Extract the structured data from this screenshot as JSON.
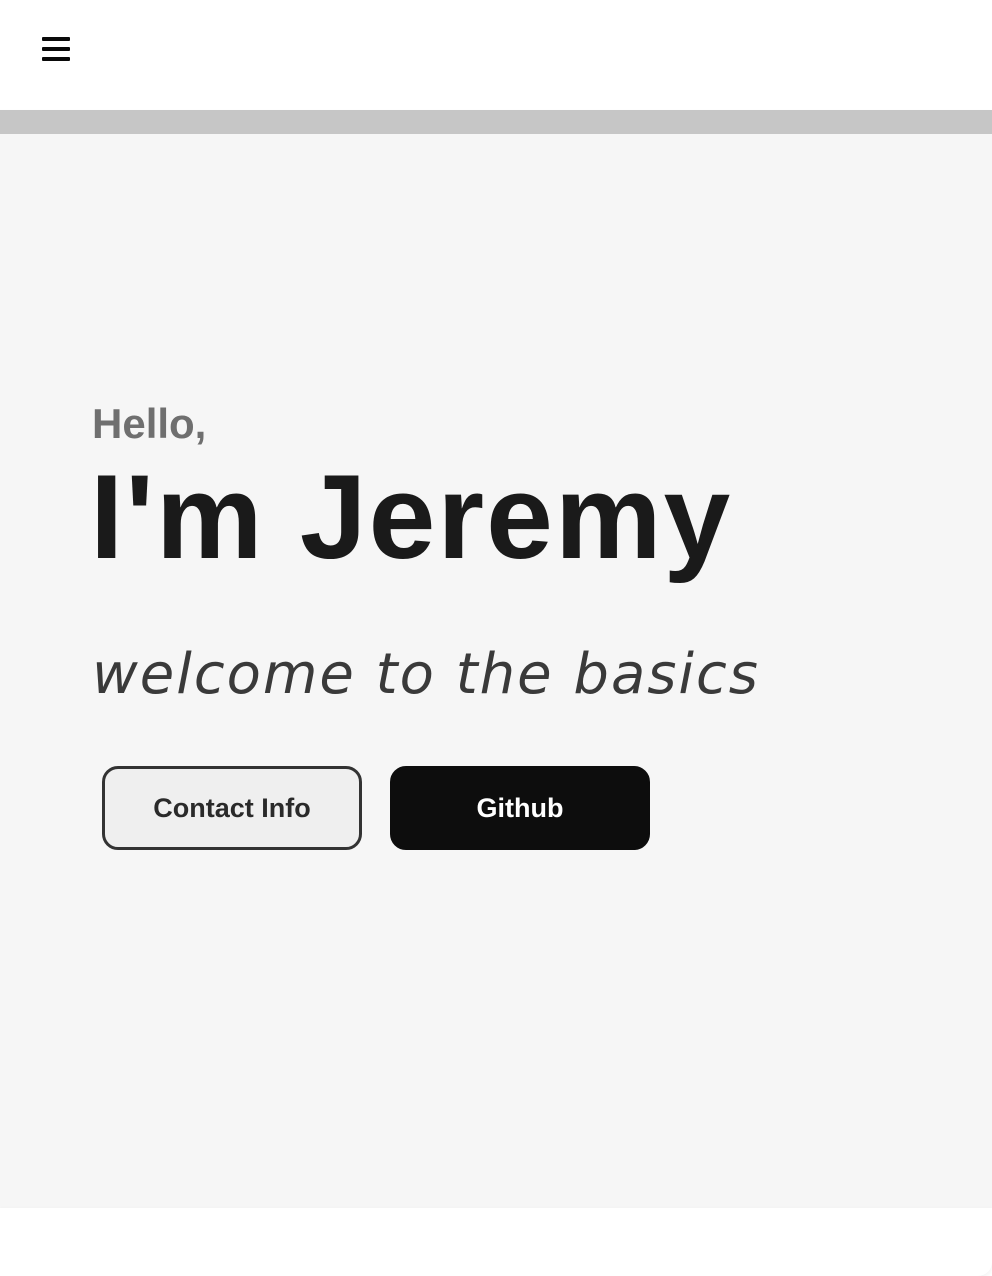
{
  "header": {
    "menu_icon": "hamburger-menu-icon"
  },
  "hero": {
    "greeting": "Hello,",
    "name": "I'm Jeremy",
    "tagline": "welcome to the basics",
    "buttons": {
      "contact_label": "Contact Info",
      "github_label": "Github"
    }
  },
  "colors": {
    "hero_background": "#f6f6f6",
    "divider": "#c6c6c6",
    "greeting_text": "#6f6f6f",
    "name_text": "#1a1a1a",
    "github_button": "#0d0d0d"
  }
}
